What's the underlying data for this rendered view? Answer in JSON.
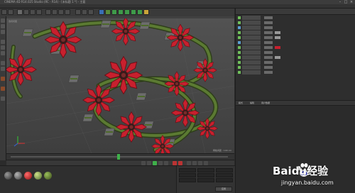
{
  "window": {
    "title": "CINEMA 4D R14.025 Studio (RC - R14) - [未标题 1 *] - 主要",
    "controls": [
      "minimize",
      "maximize",
      "close"
    ]
  },
  "viewport": {
    "label": "透视视图",
    "info": "网格间距 : 100 cm"
  },
  "timeline": {
    "current_frame_percent": 49
  },
  "coordinates": {
    "apply_label": "应用"
  },
  "object_manager": {
    "rows": 12
  },
  "attribute_manager": {
    "tabs": [
      "模式",
      "编辑",
      "用户数据"
    ]
  },
  "watermark": {
    "brand": "Baidu经验",
    "url": "jingyan.baidu.com"
  },
  "colors": {
    "accent_green": "#3fb04a",
    "flower_red": "#c8202e",
    "stem_green": "#4e6a2c"
  }
}
